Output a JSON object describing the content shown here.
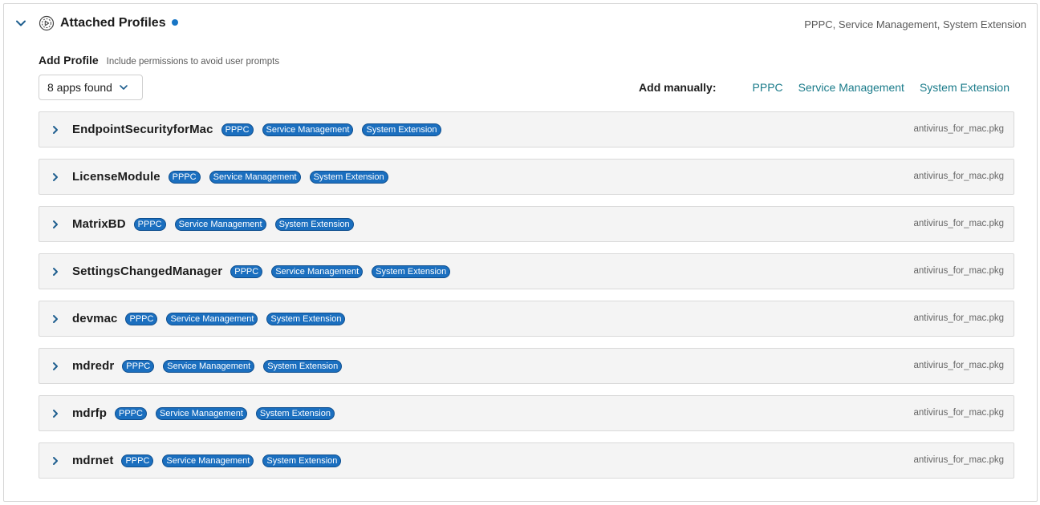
{
  "header": {
    "title": "Attached Profiles",
    "summary": "PPPC, Service Management, System Extension",
    "icon": "profile-settings-icon",
    "dot_color": "#1875c5"
  },
  "add_profile": {
    "title": "Add Profile",
    "hint": "Include permissions to avoid user prompts"
  },
  "apps_dropdown": {
    "label": "8 apps found"
  },
  "add_manually": {
    "label": "Add manually:",
    "links": [
      "PPPC",
      "Service Management",
      "System Extension"
    ]
  },
  "tag_color": "#1b6fbf",
  "link_color": "#1a7b8a",
  "apps": [
    {
      "name": "EndpointSecurityforMac",
      "tags": [
        "PPPC",
        "Service Management",
        "System Extension"
      ],
      "package": "antivirus_for_mac.pkg"
    },
    {
      "name": "LicenseModule",
      "tags": [
        "PPPC",
        "Service Management",
        "System Extension"
      ],
      "package": "antivirus_for_mac.pkg"
    },
    {
      "name": "MatrixBD",
      "tags": [
        "PPPC",
        "Service Management",
        "System Extension"
      ],
      "package": "antivirus_for_mac.pkg"
    },
    {
      "name": "SettingsChangedManager",
      "tags": [
        "PPPC",
        "Service Management",
        "System Extension"
      ],
      "package": "antivirus_for_mac.pkg"
    },
    {
      "name": "devmac",
      "tags": [
        "PPPC",
        "Service Management",
        "System Extension"
      ],
      "package": "antivirus_for_mac.pkg"
    },
    {
      "name": "mdredr",
      "tags": [
        "PPPC",
        "Service Management",
        "System Extension"
      ],
      "package": "antivirus_for_mac.pkg"
    },
    {
      "name": "mdrfp",
      "tags": [
        "PPPC",
        "Service Management",
        "System Extension"
      ],
      "package": "antivirus_for_mac.pkg"
    },
    {
      "name": "mdrnet",
      "tags": [
        "PPPC",
        "Service Management",
        "System Extension"
      ],
      "package": "antivirus_for_mac.pkg"
    }
  ]
}
